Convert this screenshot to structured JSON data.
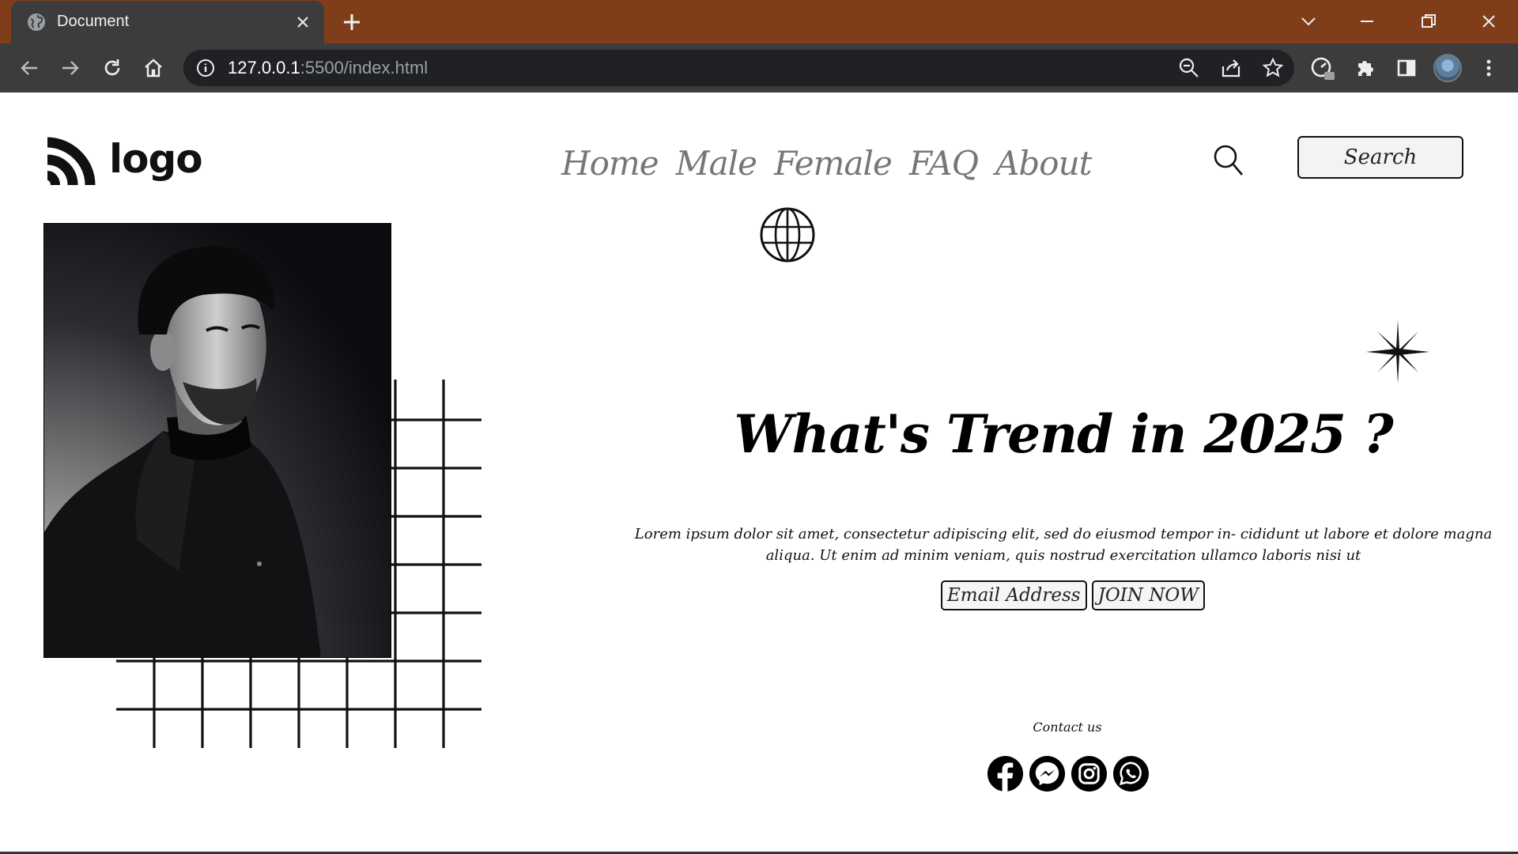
{
  "browser": {
    "tab_title": "Document",
    "url_host": "127.0.0.1",
    "url_rest": ":5500/index.html"
  },
  "site": {
    "logo_text": "logo",
    "nav": [
      "Home",
      "Male",
      "Female",
      "FAQ",
      "About"
    ],
    "search_button": "Search"
  },
  "hero": {
    "headline": "What's Trend in 2025 ?",
    "paragraph": "Lorem ipsum dolor sit amet, consectetur adipiscing elit, sed do eiusmod tempor in- cididunt ut labore et dolore magna aliqua. Ut enim ad minim veniam, quis nostrud exercitation ullamco laboris nisi ut",
    "email_placeholder": "Email Address",
    "join_button": "JOIN NOW"
  },
  "footer": {
    "contact_label": "Contact us",
    "social_icons": [
      "facebook-icon",
      "messenger-icon",
      "instagram-icon",
      "whatsapp-icon"
    ]
  },
  "colors": {
    "titlebar": "#7f3d1a",
    "toolbar": "#3c3c3c",
    "omnibox": "#202124",
    "nav_text": "#777777"
  }
}
